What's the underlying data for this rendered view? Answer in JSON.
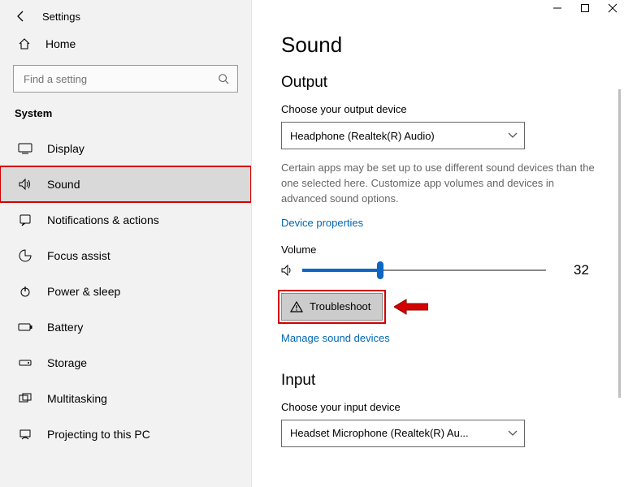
{
  "window": {
    "title": "Settings"
  },
  "sidebar": {
    "home": "Home",
    "search_placeholder": "Find a setting",
    "category": "System",
    "items": [
      {
        "label": "Display"
      },
      {
        "label": "Sound"
      },
      {
        "label": "Notifications & actions"
      },
      {
        "label": "Focus assist"
      },
      {
        "label": "Power & sleep"
      },
      {
        "label": "Battery"
      },
      {
        "label": "Storage"
      },
      {
        "label": "Multitasking"
      },
      {
        "label": "Projecting to this PC"
      }
    ]
  },
  "main": {
    "title": "Sound",
    "output": {
      "heading": "Output",
      "choose_label": "Choose your output device",
      "selected_device": "Headphone (Realtek(R) Audio)",
      "note": "Certain apps may be set up to use different sound devices than the one selected here. Customize app volumes and devices in advanced sound options.",
      "device_properties": "Device properties",
      "volume_label": "Volume",
      "volume_value": "32",
      "troubleshoot": "Troubleshoot",
      "manage_devices": "Manage sound devices"
    },
    "input": {
      "heading": "Input",
      "choose_label": "Choose your input device",
      "selected_device": "Headset Microphone (Realtek(R) Au..."
    }
  }
}
